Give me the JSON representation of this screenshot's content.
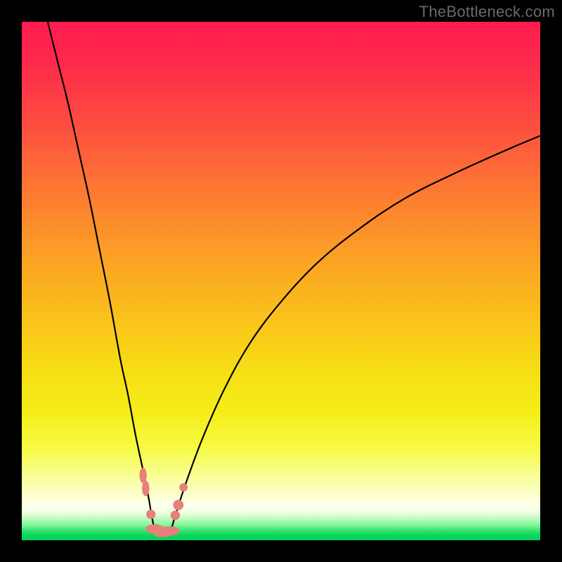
{
  "watermark": "TheBottleneck.com",
  "chart_data": {
    "type": "line",
    "title": "",
    "xlabel": "",
    "ylabel": "",
    "xlim": [
      0,
      100
    ],
    "ylim": [
      0,
      100
    ],
    "background_gradient": {
      "direction": "vertical",
      "stops": [
        {
          "pos": 0,
          "color": "#fe1b4f"
        },
        {
          "pos": 0.5,
          "color": "#fca324"
        },
        {
          "pos": 0.78,
          "color": "#f5ed18"
        },
        {
          "pos": 0.93,
          "color": "#feffef"
        },
        {
          "pos": 1.0,
          "color": "#06d15c"
        }
      ]
    },
    "series": [
      {
        "name": "left-curve",
        "x": [
          5.0,
          7.0,
          9.0,
          11.0,
          13.0,
          15.0,
          17.0,
          19.0,
          20.5,
          22.0,
          23.5,
          24.5,
          25.0,
          25.6
        ],
        "y": [
          100.0,
          92.0,
          84.0,
          75.0,
          66.0,
          56.0,
          46.0,
          35.0,
          28.0,
          20.0,
          13.0,
          8.0,
          5.0,
          2.0
        ]
      },
      {
        "name": "right-curve",
        "x": [
          28.8,
          30.0,
          32.0,
          35.0,
          39.0,
          44.0,
          50.0,
          57.0,
          65.0,
          74.0,
          84.0,
          94.0,
          100.0
        ],
        "y": [
          2.0,
          6.0,
          12.0,
          20.0,
          29.0,
          38.0,
          46.0,
          53.5,
          60.0,
          66.0,
          71.0,
          75.5,
          78.0
        ]
      }
    ],
    "flat_bottom": {
      "x_start": 25.6,
      "x_end": 28.8,
      "y": 1.5
    },
    "scatter_points": [
      {
        "x": 23.4,
        "y": 12.5,
        "r": 1.0,
        "shape": "vpill"
      },
      {
        "x": 23.9,
        "y": 10.0,
        "r": 1.0,
        "shape": "vpill"
      },
      {
        "x": 24.9,
        "y": 5.0,
        "r": 0.9,
        "shape": "dot"
      },
      {
        "x": 25.6,
        "y": 2.2,
        "r": 1.1,
        "shape": "hpill"
      },
      {
        "x": 27.2,
        "y": 1.6,
        "r": 1.3,
        "shape": "hpill"
      },
      {
        "x": 28.7,
        "y": 1.8,
        "r": 1.1,
        "shape": "hpill"
      },
      {
        "x": 29.6,
        "y": 4.8,
        "r": 0.9,
        "shape": "dot"
      },
      {
        "x": 30.2,
        "y": 6.8,
        "r": 1.0,
        "shape": "dot"
      },
      {
        "x": 31.2,
        "y": 10.2,
        "r": 0.8,
        "shape": "dot"
      }
    ]
  },
  "colors": {
    "frame": "#000000",
    "curve": "#000000",
    "dots": "#e77f7b",
    "watermark": "#6a6a6a"
  }
}
